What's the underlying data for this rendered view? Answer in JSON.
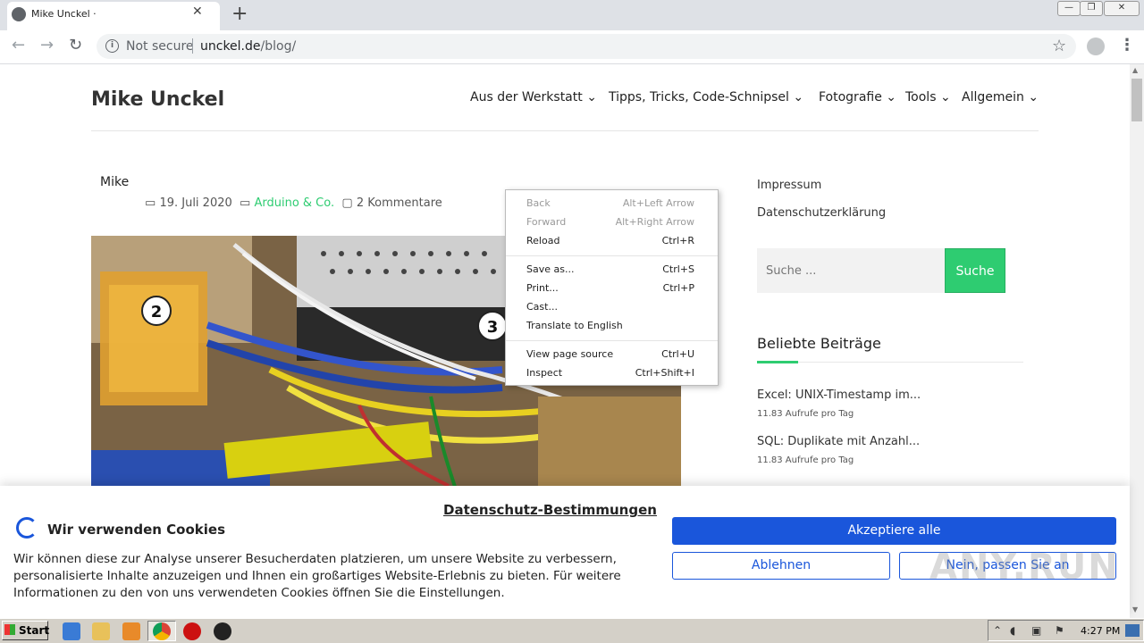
{
  "browser": {
    "tab_title": "Mike Unckel ·",
    "new_tab": "+",
    "close_tab": "✕",
    "security_label": "Not secure",
    "url_host": "unckel.de",
    "url_path": "/blog/"
  },
  "site": {
    "title": "Mike Unckel",
    "nav": [
      {
        "label": "Aus der Werkstatt"
      },
      {
        "label": "Tipps, Tricks, Code-Schnipsel"
      },
      {
        "label": "Fotografie"
      },
      {
        "label": "Tools"
      },
      {
        "label": "Allgemein"
      }
    ]
  },
  "post": {
    "author": "Mike",
    "date": "19. Juli 2020",
    "category": "Arduino & Co.",
    "comments": "2 Kommentare",
    "image_badge_1": "2",
    "image_badge_2": "3"
  },
  "sidebar": {
    "links": [
      "Impressum",
      "Datenschutzerklärung"
    ],
    "search_placeholder": "Suche ...",
    "search_button": "Suche",
    "popular_title": "Beliebte Beiträge",
    "popular": [
      {
        "title": "Excel: UNIX-Timestamp im...",
        "meta": "11.83 Aufrufe pro Tag"
      },
      {
        "title": "SQL: Duplikate mit Anzahl...",
        "meta": "11.83 Aufrufe pro Tag"
      }
    ]
  },
  "context_menu": {
    "items": [
      {
        "label": "Back",
        "shortcut": "Alt+Left Arrow",
        "disabled": true
      },
      {
        "label": "Forward",
        "shortcut": "Alt+Right Arrow",
        "disabled": true
      },
      {
        "label": "Reload",
        "shortcut": "Ctrl+R",
        "disabled": false
      },
      {
        "label": "Save as...",
        "shortcut": "Ctrl+S",
        "disabled": false
      },
      {
        "label": "Print...",
        "shortcut": "Ctrl+P",
        "disabled": false
      },
      {
        "label": "Cast...",
        "shortcut": "",
        "disabled": false
      },
      {
        "label": "Translate to English",
        "shortcut": "",
        "disabled": false
      },
      {
        "label": "View page source",
        "shortcut": "Ctrl+U",
        "disabled": false
      },
      {
        "label": "Inspect",
        "shortcut": "Ctrl+Shift+I",
        "disabled": false
      }
    ]
  },
  "cookie": {
    "title": "Wir verwenden Cookies",
    "privacy_link": "Datenschutz-Bestimmungen",
    "text": "Wir können diese zur Analyse unserer Besucherdaten platzieren, um unsere Website zu verbessern, personalisierte Inhalte anzuzeigen und Ihnen ein großartiges Website-Erlebnis zu bieten. Für weitere Informationen zu den von uns verwendeten Cookies öffnen Sie die Einstellungen.",
    "accept_all": "Akzeptiere alle",
    "decline": "Ablehnen",
    "customize": "Nein, passen Sie an"
  },
  "watermark": "ANY.RUN",
  "taskbar": {
    "start": "Start",
    "clock": "4:27 PM"
  },
  "colors": {
    "accent_green": "#2ecc71",
    "cookie_blue": "#1a56db"
  }
}
